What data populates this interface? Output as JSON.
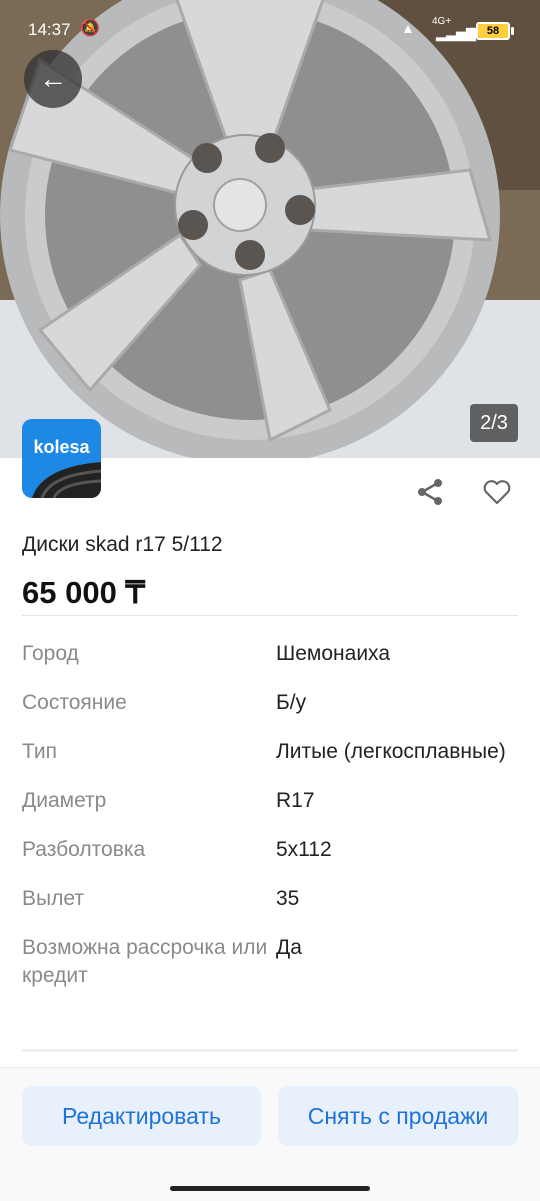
{
  "status_bar": {
    "time": "14:37",
    "network": "4G+",
    "battery": "58"
  },
  "photo": {
    "counter": "2/3"
  },
  "brand": {
    "logo_text": "kolesa",
    "accent": "#1e88e5"
  },
  "listing": {
    "title": "Диски skad r17 5/112",
    "price": "65 000 ₸"
  },
  "specs": [
    {
      "label": "Город",
      "value": "Шемонаиха"
    },
    {
      "label": "Состояние",
      "value": "Б/у"
    },
    {
      "label": "Тип",
      "value": "Литые (легкосплавные)"
    },
    {
      "label": "Диаметр",
      "value": "R17"
    },
    {
      "label": "Разболтовка",
      "value": "5x112"
    },
    {
      "label": "Вылет",
      "value": "35"
    },
    {
      "label": "Возможна рассрочка или кредит",
      "value": "Да"
    }
  ],
  "actions": {
    "edit_label": "Редактировать",
    "remove_label": "Снять с продажи",
    "button_color": "#1e73d6"
  },
  "icons": [
    "back-arrow-icon",
    "share-icon",
    "heart-icon",
    "mute-icon",
    "wifi-icon",
    "signal-icon",
    "battery-icon"
  ]
}
